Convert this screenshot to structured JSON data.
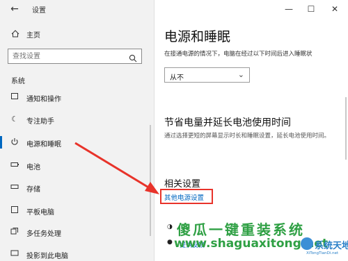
{
  "window": {
    "title": "设置",
    "controls": {
      "minimize": "—",
      "maximize": "☐",
      "close": "✕"
    }
  },
  "sidebar": {
    "home": "主页",
    "search_placeholder": "查找设置",
    "section": "系统",
    "items": [
      {
        "label": "通知和操作",
        "icon": "notification-icon"
      },
      {
        "label": "专注助手",
        "icon": "moon-icon"
      },
      {
        "label": "电源和睡眠",
        "icon": "power-icon",
        "active": true
      },
      {
        "label": "电池",
        "icon": "battery-icon"
      },
      {
        "label": "存储",
        "icon": "storage-icon"
      },
      {
        "label": "平板电脑",
        "icon": "tablet-icon"
      },
      {
        "label": "多任务处理",
        "icon": "multitask-icon"
      },
      {
        "label": "投影到此电脑",
        "icon": "project-icon"
      }
    ]
  },
  "main": {
    "title": "电源和睡眠",
    "sleep_desc": "在接通电源的情况下，电脑在经过以下时间后进入睡眠状",
    "sleep_value": "从不",
    "save_title": "节省电量并延长电池使用时间",
    "save_desc": "通过选择更短的屏幕显示时长和睡眠设置，延长电池使用时间。",
    "related_title": "相关设置",
    "related_link": "其他电源设置",
    "partial_link": "提供反馈"
  },
  "watermark": {
    "line1": "傻瓜一键重装系统",
    "line2": "www.shaguaxitong.net",
    "logo": "系统天地",
    "logo_sub": "XiTongTianDi.net"
  },
  "colors": {
    "accent": "#0067c0",
    "arrow": "#e8332a",
    "watermark": "#2fa044"
  }
}
